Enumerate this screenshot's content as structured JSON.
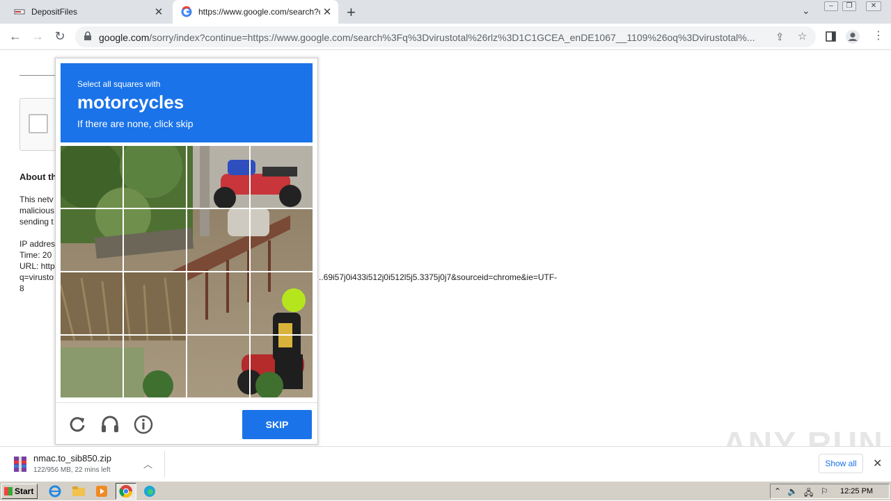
{
  "browser": {
    "tabs": [
      {
        "title": "DepositFiles",
        "active": false
      },
      {
        "title": "https://www.google.com/search?q=",
        "active": true
      }
    ],
    "new_tab": "+",
    "tab_close": "✕",
    "url_domain": "google.com",
    "url_rest": "/sorry/index?continue=https://www.google.com/search%3Fq%3Dvirustotal%26rlz%3D1C1GCEA_enDE1067__1109%26oq%3Dvirustotal%..."
  },
  "page": {
    "about_heading": "About th",
    "para_lines": [
      "This netv",
      "malicious",
      "sending t"
    ],
    "ip_line": "IP addres",
    "time_line": "Time: 20",
    "url_line": "URL: http",
    "q_line": "q=virusto",
    "url_tail": "..69i57j0i433i512j0i512l5j5.3375j0j7&sourceid=chrome&ie=UTF-",
    "url_tail2": "8"
  },
  "captcha": {
    "small_text": "Select all squares with",
    "target": "motorcycles",
    "hint": "If there are none, click skip",
    "skip_label": "SKIP",
    "grid_rows": 4,
    "grid_cols": 4
  },
  "download": {
    "file_name": "nmac.to_sib850.zip",
    "status": "122/956 MB, 22 mins left",
    "show_all": "Show all"
  },
  "watermark": "ANY RUN",
  "taskbar": {
    "start_label": "Start",
    "clock": "12:25 PM"
  },
  "colors": {
    "accent": "#1a73e8",
    "taskbar": "#d4d0c8"
  }
}
